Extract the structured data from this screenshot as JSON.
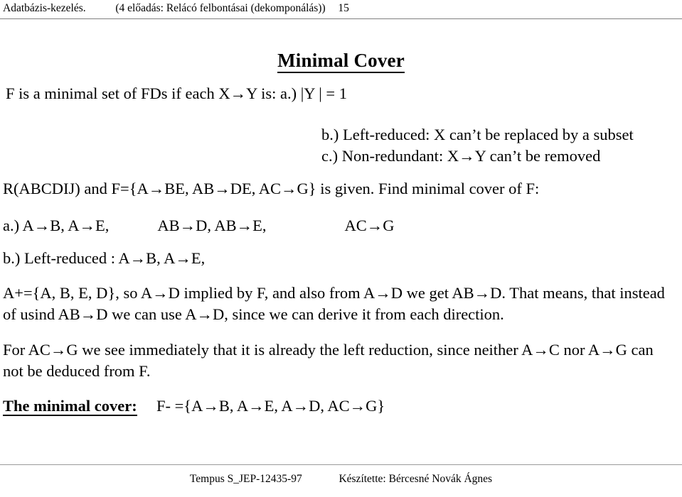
{
  "header": {
    "course": "Adatbázis-kezelés.",
    "topic": "(4 előadás: Relácó felbontásai (dekomponálás))",
    "page_number": "15"
  },
  "slide": {
    "title": "Minimal Cover",
    "definition_line": "F is a minimal set of FDs if each X→Y is: a.)  |Y | = 1",
    "condition_b": "b.)   Left-reduced: X can’t be replaced by a subset",
    "condition_c": "c.)   Non-redundant: X→Y  can’t be removed",
    "given_line": "R(ABCDIJ) and F={A→BE, AB→DE, AC→G} is given. Find minimal cover of F:",
    "step_a_label": "a.) A→B, A→E,",
    "step_a_mid": "AB→D, AB→E,",
    "step_a_end": "AC→G",
    "step_b": "b.) Left-reduced :  A→B, A→E,",
    "paragraph_1": "A+={A, B, E, D}, so  A→D implied by F, and also from A→D we get AB→D. That means, that instead of usind AB→D we can use A→D, since we can derive it from each direction.",
    "paragraph_2": "For AC→G we see immediately that it is already the left reduction, since neither A→C nor A→G can not be deduced from F.",
    "result_label": "The minimal cover:",
    "result_value": "F- ={A→B, A→E,  A→D, AC→G}"
  },
  "footer": {
    "project": "Tempus S_JEP-12435-97",
    "author": "Készítette: Bércesné Novák Ágnes"
  },
  "colors": {
    "text": "#000000",
    "rule": "#808080",
    "footer_rule": "#9a9a9a",
    "background": "#ffffff"
  }
}
